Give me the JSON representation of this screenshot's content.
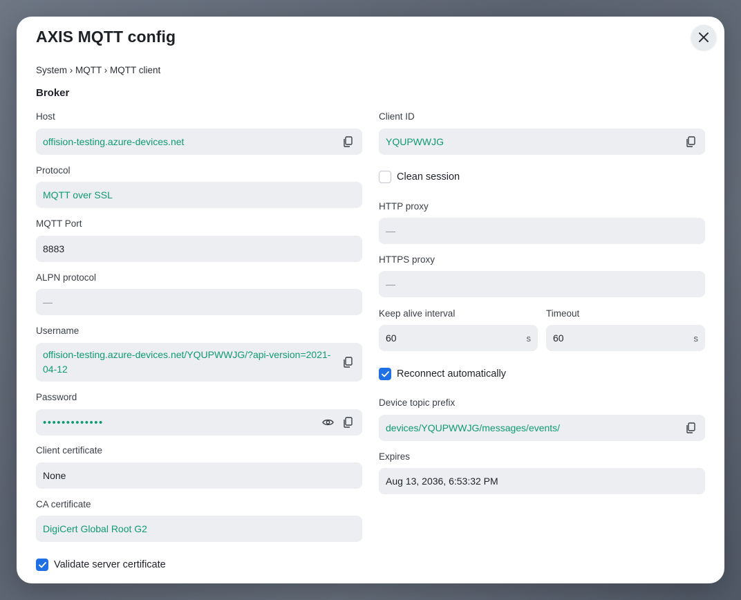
{
  "modal": {
    "title": "AXIS MQTT config",
    "breadcrumb": "System › MQTT › MQTT client",
    "section": "Broker"
  },
  "fields": {
    "host": {
      "label": "Host",
      "value": "offision-testing.azure-devices.net"
    },
    "protocol": {
      "label": "Protocol",
      "value": "MQTT over SSL"
    },
    "port": {
      "label": "MQTT Port",
      "value": "8883"
    },
    "alpn": {
      "label": "ALPN protocol",
      "value": "—"
    },
    "username": {
      "label": "Username",
      "value": "offision-testing.azure-devices.net/YQUPWWJG/?api-version=2021-04-12"
    },
    "password": {
      "label": "Password",
      "value": "•••••••••••••"
    },
    "client_cert": {
      "label": "Client certificate",
      "value": "None"
    },
    "ca_cert": {
      "label": "CA certificate",
      "value": "DigiCert Global Root G2"
    },
    "client_id": {
      "label": "Client ID",
      "value": "YQUPWWJG"
    },
    "http_proxy": {
      "label": "HTTP proxy",
      "value": "—"
    },
    "https_proxy": {
      "label": "HTTPS proxy",
      "value": "—"
    },
    "keep_alive": {
      "label": "Keep alive interval",
      "value": "60",
      "unit": "s"
    },
    "timeout": {
      "label": "Timeout",
      "value": "60",
      "unit": "s"
    },
    "topic_prefix": {
      "label": "Device topic prefix",
      "value": "devices/YQUPWWJG/messages/events/"
    },
    "expires": {
      "label": "Expires",
      "value": "Aug 13, 2036, 6:53:32 PM"
    }
  },
  "checks": {
    "clean_session": {
      "label": "Clean session",
      "checked": false
    },
    "reconnect": {
      "label": "Reconnect automatically",
      "checked": true
    },
    "validate_cert": {
      "label": "Validate server certificate",
      "checked": true
    }
  },
  "colors": {
    "accent_green": "#0f9a73",
    "checkbox_blue": "#1f6fe5",
    "field_bg": "#eceef1"
  }
}
